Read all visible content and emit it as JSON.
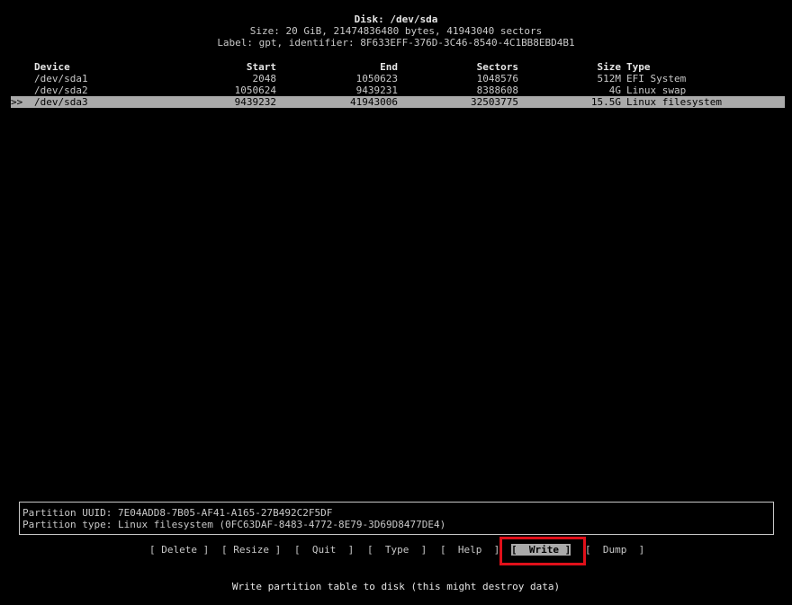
{
  "header": {
    "disk_title": "Disk: /dev/sda",
    "size_line": "Size: 20 GiB, 21474836480 bytes, 41943040 sectors",
    "label_line": "Label: gpt, identifier: 8F633EFF-376D-3C46-8540-4C1BB8EBD4B1"
  },
  "table": {
    "columns": {
      "device": "Device",
      "start": "Start",
      "end": "End",
      "sectors": "Sectors",
      "size": "Size",
      "type": "Type"
    },
    "rows": [
      {
        "marker": "",
        "device": "/dev/sda1",
        "start": "2048",
        "end": "1050623",
        "sectors": "1048576",
        "size": "512M",
        "type": "EFI System"
      },
      {
        "marker": "",
        "device": "/dev/sda2",
        "start": "1050624",
        "end": "9439231",
        "sectors": "8388608",
        "size": "4G",
        "type": "Linux swap"
      },
      {
        "marker": ">>",
        "device": "/dev/sda3",
        "start": "9439232",
        "end": "41943006",
        "sectors": "32503775",
        "size": "15.5G",
        "type": "Linux filesystem"
      }
    ]
  },
  "info": {
    "uuid_line": "Partition UUID: 7E04ADD8-7B05-AF41-A165-27B492C2F5DF",
    "type_line": "Partition type: Linux filesystem (0FC63DAF-8483-4772-8E79-3D69D8477DE4)"
  },
  "menu": {
    "delete": "[ Delete ]",
    "resize": "[ Resize ]",
    "quit": "[  Quit  ]",
    "type": "[  Type  ]",
    "help": "[  Help  ]",
    "write": "[  Write ]",
    "dump": "[  Dump  ]"
  },
  "hint": "Write partition table to disk (this might destroy data)",
  "colors": {
    "background": "#000000",
    "text": "#c8c8c8",
    "selection": "#aaaaaa",
    "highlight_frame": "#e0101a"
  }
}
